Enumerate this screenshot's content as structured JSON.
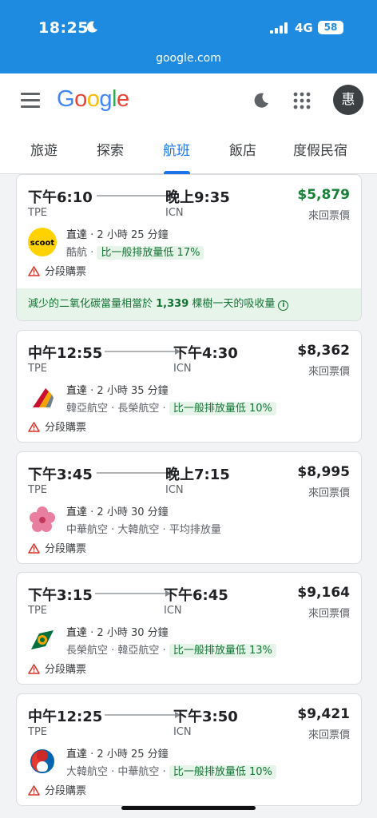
{
  "status_bar": {
    "time": "18:25",
    "network": "4G",
    "battery": "58"
  },
  "browser": {
    "url": "google.com"
  },
  "header": {
    "logo_letters": [
      {
        "ch": "G",
        "color": "#4285F4"
      },
      {
        "ch": "o",
        "color": "#EA4335"
      },
      {
        "ch": "o",
        "color": "#FBBC05"
      },
      {
        "ch": "g",
        "color": "#4285F4"
      },
      {
        "ch": "l",
        "color": "#34A853"
      },
      {
        "ch": "e",
        "color": "#EA4335"
      }
    ],
    "avatar_initial": "惠",
    "tabs": [
      "旅遊",
      "探索",
      "航班",
      "飯店",
      "度假民宿"
    ],
    "active_tab": "航班"
  },
  "flights": [
    {
      "dep_time": "下午6:10",
      "arr_time": "晚上9:35",
      "dep_code": "TPE",
      "arr_code": "ICN",
      "price": "$5,879",
      "price_note": "來回票價",
      "stops": "直達",
      "duration": "2 小時 25 分鐘",
      "airlines": "酷航",
      "emissions": "比一般排放量低 17%",
      "warning": "分段購票",
      "logo": "scoot-logo-icon",
      "banner_prefix": "減少的二氧化碳當量相當於 ",
      "banner_count": "1,339",
      "banner_suffix": " 棵樹一天的吸收量"
    },
    {
      "dep_time": "中午12:55",
      "arr_time": "下午4:30",
      "dep_code": "TPE",
      "arr_code": "ICN",
      "price": "$8,362",
      "price_note": "來回票價",
      "stops": "直達",
      "duration": "2 小時 35 分鐘",
      "airlines": "韓亞航空 · 長榮航空",
      "emissions": "比一般排放量低 10%",
      "warning": "分段購票",
      "logo": "asiana-logo-icon"
    },
    {
      "dep_time": "下午3:45",
      "arr_time": "晚上7:15",
      "dep_code": "TPE",
      "arr_code": "ICN",
      "price": "$8,995",
      "price_note": "來回票價",
      "stops": "直達",
      "duration": "2 小時 30 分鐘",
      "airlines": "中華航空 · 大韓航空",
      "emissions": "平均排放量",
      "warning": "分段購票",
      "logo": "china-airlines-plum-icon"
    },
    {
      "dep_time": "下午3:15",
      "arr_time": "下午6:45",
      "dep_code": "TPE",
      "arr_code": "ICN",
      "price": "$9,164",
      "price_note": "來回票價",
      "stops": "直達",
      "duration": "2 小時 30 分鐘",
      "airlines": "長榮航空 · 韓亞航空",
      "emissions": "比一般排放量低 13%",
      "warning": "分段購票",
      "logo": "eva-air-logo-icon"
    },
    {
      "dep_time": "中午12:25",
      "arr_time": "下午3:50",
      "dep_code": "TPE",
      "arr_code": "ICN",
      "price": "$9,421",
      "price_note": "來回票價",
      "stops": "直達",
      "duration": "2 小時 25 分鐘",
      "airlines": "大韓航空 · 中華航空",
      "emissions": "比一般排放量低 10%",
      "warning": "分段購票",
      "logo": "korean-air-logo-icon"
    }
  ],
  "colors": {
    "accent": "#1a73e8",
    "price_green": "#188038",
    "emission_bg": "#e6f4ea",
    "warning_red": "#d93025"
  }
}
